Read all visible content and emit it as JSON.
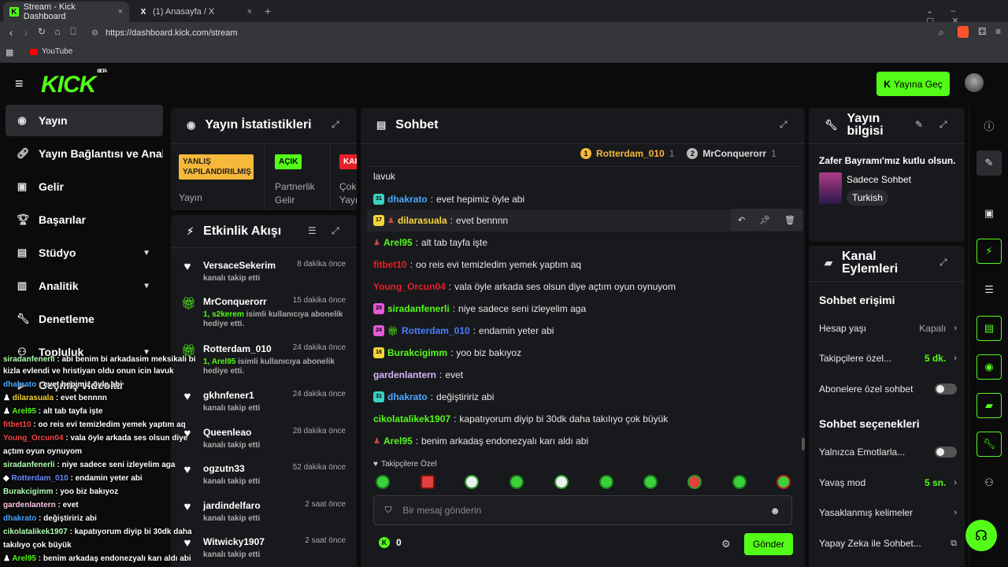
{
  "browser": {
    "tabs": [
      {
        "title": "Stream - Kick Dashboard",
        "close": "×"
      },
      {
        "title": "(1) Anasayfa / X",
        "close": "×"
      }
    ],
    "new_tab": "+",
    "url": "https://dashboard.kick.com/stream",
    "bookmark": "YouTube"
  },
  "header": {
    "logo": "KICK",
    "logo_badge": "BETA",
    "go_live": "Yayına Geç"
  },
  "sidebar": {
    "items": [
      {
        "label": "Yayın"
      },
      {
        "label": "Yayın Bağlantısı ve Anahtarı"
      },
      {
        "label": "Gelir"
      },
      {
        "label": "Başarılar"
      },
      {
        "label": "Stüdyo"
      },
      {
        "label": "Analitik"
      },
      {
        "label": "Denetleme"
      },
      {
        "label": "Topluluk"
      },
      {
        "label": "Geçmiş videolar"
      }
    ]
  },
  "stats": {
    "title": "Yayın İstatistikleri",
    "badges": [
      {
        "text": "YANLIŞ YAPILANDIRILMIŞ",
        "label": "Yayın",
        "color": "#f6b83a"
      },
      {
        "text": "AÇIK",
        "label": "Partnerlik Gelir",
        "color": "#53fc18"
      },
      {
        "text": "KAP",
        "label": "Çok Yayı",
        "color": "#e5202b"
      }
    ]
  },
  "activity": {
    "title": "Etkinlik Akışı",
    "events": [
      {
        "icon": "heart",
        "name": "VersaceSekerim",
        "time": "8 dakika önce",
        "sub": "kanalı takip etti"
      },
      {
        "icon": "gift",
        "name": "MrConquerorr",
        "time": "15 dakika önce",
        "hl": "1, s2kerem",
        "sub": "isimli kullanıcıya abonelik hediye etti."
      },
      {
        "icon": "gift",
        "name": "Rotterdam_010",
        "time": "24 dakika önce",
        "hl": "1, Arel95",
        "sub": "isimli kullanıcıya abonelik hediye etti."
      },
      {
        "icon": "heart",
        "name": "gkhnfener1",
        "time": "24 dakika önce",
        "sub": "kanalı takip etti"
      },
      {
        "icon": "heart",
        "name": "Queenleao",
        "time": "28 dakika önce",
        "sub": "kanalı takip etti"
      },
      {
        "icon": "heart",
        "name": "ogzutn33",
        "time": "52 dakika önce",
        "sub": "kanalı takip etti"
      },
      {
        "icon": "heart",
        "name": "jardindelfaro",
        "time": "2 saat önce",
        "sub": "kanalı takip etti"
      },
      {
        "icon": "heart",
        "name": "Witwicky1907",
        "time": "2 saat önce",
        "sub": "kanalı takip etti"
      }
    ]
  },
  "chat": {
    "title": "Sohbet",
    "top_gifters": [
      {
        "rank": "1",
        "name": "Rotterdam_010",
        "count": "1"
      },
      {
        "rank": "2",
        "name": "MrConquerorr",
        "count": "1"
      }
    ],
    "messages": [
      {
        "user": "",
        "text": "lavuk",
        "color": "#ffffff"
      },
      {
        "badge": "31",
        "user": "dhakrato",
        "text": "evet hepimiz öyle abi",
        "color": "#4aa8ff"
      },
      {
        "badge": "17",
        "user": "dilarasuala",
        "text": "evet bennnn",
        "color": "#f6d53a"
      },
      {
        "user": "Arel95",
        "text": "alt tab tayfa işte",
        "color": "#53fc18"
      },
      {
        "user": "fitbet10",
        "text": "oo reis evi temizledim yemek yaptım aq",
        "color": "#e5202b"
      },
      {
        "user": "Young_Orcun04",
        "text": "vala öyle arkada ses olsun diye açtım oyun oynuyom",
        "color": "#e5202b"
      },
      {
        "badge": "25",
        "user": "siradanfenerli",
        "text": "niye sadece seni izleyelim aga",
        "color": "#53fc18"
      },
      {
        "badge": "24",
        "user": "Rotterdam_010",
        "text": "endamin yeter abi",
        "color": "#4a7dff"
      },
      {
        "badge": "16",
        "user": "Burakcigimm",
        "text": "yoo biz bakıyoz",
        "color": "#53fc18"
      },
      {
        "user": "gardenlantern",
        "text": "evet",
        "color": "#d9b3ff"
      },
      {
        "badge": "31",
        "user": "dhakrato",
        "text": "değiştiririz abi",
        "color": "#4aa8ff"
      },
      {
        "user": "cikolatalikek1907",
        "text": "kapatıyorum diyip bi 30dk daha takılıyo çok büyük",
        "color": "#53fc18"
      },
      {
        "user": "Arel95",
        "text": "benim arkadaş endonezyalı karı aldı abi",
        "color": "#53fc18"
      }
    ],
    "followers_only": "Takipçilere Özel",
    "input_placeholder": "Bir mesaj gönderin",
    "points": "0",
    "send": "Gönder"
  },
  "stream_info": {
    "title": "Yayın bilgisi",
    "stream_title": "Zafer Bayramı'mız kutlu olsun.",
    "category": "Sadece Sohbet",
    "language": "Turkish"
  },
  "channel_actions": {
    "title": "Kanal Eylemleri",
    "chat_access": "Sohbet erişimi",
    "account_age": {
      "label": "Hesap yaşı",
      "value": "Kapalı"
    },
    "followers_only": {
      "label": "Takipçilere özel...",
      "value": "5 dk."
    },
    "subs_only": {
      "label": "Abonelere özel sohbet"
    },
    "chat_options": "Sohbet seçenekleri",
    "emotes_only": {
      "label": "Yalnızca Emotlarla..."
    },
    "slow_mode": {
      "label": "Yavaş mod",
      "value": "5 sn."
    },
    "banned_words": {
      "label": "Yasaklanmış kelimeler"
    },
    "ai": {
      "label": "Yapay Zeka ile Sohbet..."
    }
  },
  "overlay": {
    "lines": [
      {
        "user": "siradanfenerli",
        "text": " : abi benim bi arkadasim meksikali bi",
        "color": "#b3ffb3"
      },
      {
        "user": "",
        "text": "kizla evlendi ve hristiyan oldu onun icin lavuk",
        "color": "#ffffff"
      },
      {
        "user": "dhakrato",
        "text": " : evet hepimiz öyle abi",
        "color": "#4aa8ff"
      },
      {
        "user": "dilarasuala",
        "text": " : evet bennnn",
        "color": "#f6d53a"
      },
      {
        "user": "Arel95",
        "text": " : alt tab tayfa işte",
        "color": "#53fc18"
      },
      {
        "user": "fitbet10",
        "text": " : oo reis evi temizledim yemek yaptım aq",
        "color": "#ff4444"
      },
      {
        "user": "Young_Orcun04",
        "text": " : vala öyle arkada ses olsun diye",
        "color": "#ff4444"
      },
      {
        "user": "",
        "text": "açtım oyun oynuyom",
        "color": "#ffffff"
      },
      {
        "user": "siradanfenerli",
        "text": " : niye sadece seni izleyelim aga",
        "color": "#b3ffb3"
      },
      {
        "user": "Rotterdam_010",
        "text": " : endamin yeter abi",
        "color": "#6b8cff"
      },
      {
        "user": "Burakcigimm",
        "text": " : yoo biz bakıyoz",
        "color": "#b3ffb3"
      },
      {
        "user": "gardenlantern",
        "text": " : evet",
        "color": "#ffc6e6"
      },
      {
        "user": "dhakrato",
        "text": " : değiştiririz abi",
        "color": "#4aa8ff"
      },
      {
        "user": "cikolatalikek1907",
        "text": " : kapatıyorum diyip bi 30dk daha",
        "color": "#b3ffb3"
      },
      {
        "user": "",
        "text": "takılıyo çok büyük",
        "color": "#ffffff"
      },
      {
        "user": "Arel95",
        "text": " : benim arkadaş endonezyalı karı aldı abi",
        "color": "#53fc18"
      }
    ]
  }
}
